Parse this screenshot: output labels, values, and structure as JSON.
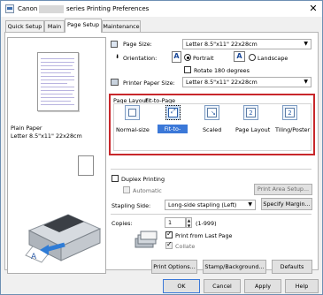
{
  "window": {
    "title_prefix": "Canon",
    "title_suffix": "series Printing Preferences",
    "close_label": "✕"
  },
  "tabs": [
    {
      "label": "Quick Setup"
    },
    {
      "label": "Main"
    },
    {
      "label": "Page Setup",
      "selected": true
    },
    {
      "label": "Maintenance"
    }
  ],
  "preview": {
    "paper_label": "Plain Paper",
    "size_label": "Letter 8.5\"x11\" 22x28cm"
  },
  "page_size": {
    "label": "Page Size:",
    "value": "Letter 8.5\"x11\" 22x28cm"
  },
  "orientation": {
    "label": "Orientation:",
    "portrait": "Portrait",
    "landscape": "Landscape",
    "rotate": "Rotate 180 degrees",
    "selected": "Portrait"
  },
  "printer_paper_size": {
    "label": "Printer Paper Size:",
    "value": "Letter 8.5\"x11\" 22x28cm"
  },
  "page_layout": {
    "label": "Page Layout:",
    "current": "Fit-to-Page",
    "options": [
      {
        "label": "Normal-size",
        "icon": "normal-size-icon"
      },
      {
        "label": "Fit-to-Page",
        "icon": "fit-to-page-icon",
        "selected": true
      },
      {
        "label": "Scaled",
        "icon": "scaled-icon"
      },
      {
        "label": "Page Layout",
        "icon": "page-layout-icon"
      },
      {
        "label": "Tiling/Poster",
        "icon": "tiling-poster-icon"
      }
    ]
  },
  "duplex": {
    "label": "Duplex Printing",
    "automatic": "Automatic",
    "print_area": "Print Area Setup..."
  },
  "stapling": {
    "label": "Stapling Side:",
    "value": "Long-side stapling (Left)",
    "margin_button": "Specify Margin..."
  },
  "copies": {
    "label": "Copies:",
    "value": "1",
    "range": "(1-999)",
    "print_last": "Print from Last Page",
    "collate": "Collate"
  },
  "buttons": {
    "print_options": "Print Options...",
    "stamp": "Stamp/Background...",
    "defaults": "Defaults",
    "ok": "OK",
    "cancel": "Cancel",
    "apply": "Apply",
    "help": "Help"
  },
  "colors": {
    "accent": "#c8272b",
    "selected_blue": "#3b78d8"
  }
}
